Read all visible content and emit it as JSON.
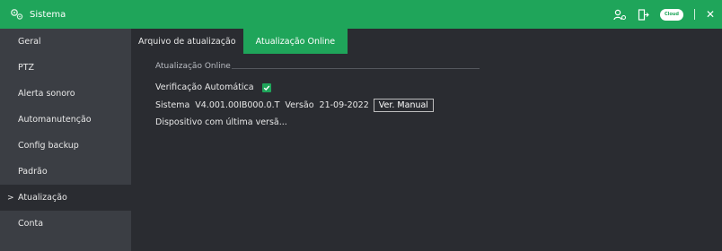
{
  "window": {
    "title": "Sistema",
    "accent_color": "#1fa55a",
    "icons": [
      "gear-icon",
      "user-settings-icon",
      "exit-icon",
      "cloud-icon",
      "close-icon"
    ],
    "cloud_badge": "Cloud"
  },
  "sidebar": {
    "items": [
      {
        "label": "Geral",
        "active": false
      },
      {
        "label": "PTZ",
        "active": false
      },
      {
        "label": "Alerta sonoro",
        "active": false
      },
      {
        "label": "Automanutenção",
        "active": false
      },
      {
        "label": "Config backup",
        "active": false
      },
      {
        "label": "Padrão",
        "active": false
      },
      {
        "label": "Atualização",
        "active": true,
        "chevron": ">"
      },
      {
        "label": "Conta",
        "active": false
      }
    ]
  },
  "tabs": [
    {
      "label": "Arquivo de atualização",
      "active": false
    },
    {
      "label": "Atualização Online",
      "active": true
    }
  ],
  "online_update": {
    "group_title": "Atualização Online",
    "auto_check_label": "Verificação Automática",
    "auto_check_checked": true,
    "system_label": "Sistema",
    "system_version": "V4.001.00IB000.0.T",
    "version_label": "Versão",
    "version_date": "21-09-2022",
    "manual_check_button": "Ver. Manual",
    "status_text": "Dispositivo com última versã..."
  }
}
